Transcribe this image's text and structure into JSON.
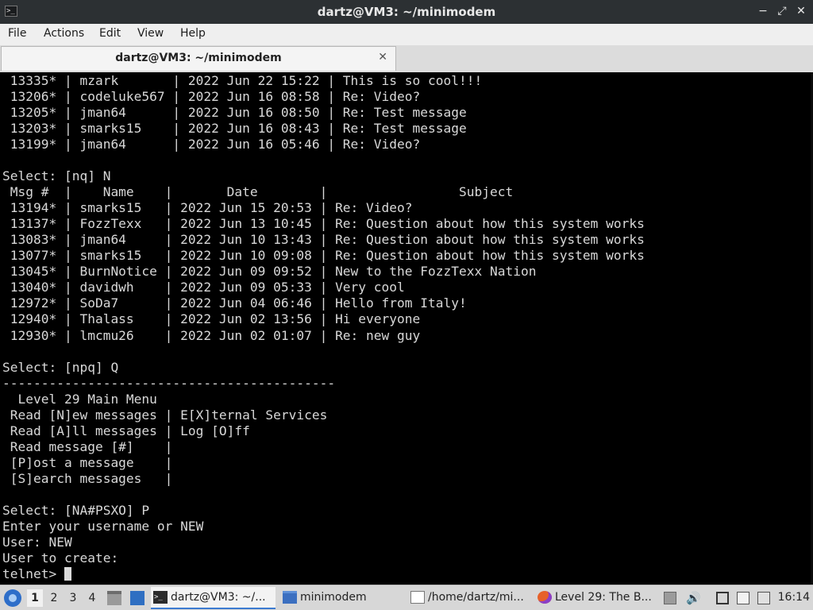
{
  "window": {
    "title": "dartz@VM3: ~/minimodem",
    "terminal_icon": ">_",
    "controls": {
      "minimize": "−",
      "maximize": "⤢",
      "close": "✕"
    }
  },
  "menu": [
    "File",
    "Actions",
    "Edit",
    "View",
    "Help"
  ],
  "tab": {
    "label": "dartz@VM3: ~/minimodem",
    "close": "✕"
  },
  "terminal": {
    "lines": [
      " 13335* | mzark       | 2022 Jun 22 15:22 | This is so cool!!!",
      " 13206* | codeluke567 | 2022 Jun 16 08:58 | Re: Video?",
      " 13205* | jman64      | 2022 Jun 16 08:50 | Re: Test message",
      " 13203* | smarks15    | 2022 Jun 16 08:43 | Re: Test message",
      " 13199* | jman64      | 2022 Jun 16 05:46 | Re: Video?",
      "",
      "Select: [nq] N",
      " Msg #  |    Name    |       Date        |                 Subject",
      " 13194* | smarks15   | 2022 Jun 15 20:53 | Re: Video?",
      " 13137* | FozzTexx   | 2022 Jun 13 10:45 | Re: Question about how this system works",
      " 13083* | jman64     | 2022 Jun 10 13:43 | Re: Question about how this system works",
      " 13077* | smarks15   | 2022 Jun 10 09:08 | Re: Question about how this system works",
      " 13045* | BurnNotice | 2022 Jun 09 09:52 | New to the FozzTexx Nation",
      " 13040* | davidwh    | 2022 Jun 09 05:33 | Very cool",
      " 12972* | SoDa7      | 2022 Jun 04 06:46 | Hello from Italy!",
      " 12940* | Thalass    | 2022 Jun 02 13:56 | Hi everyone",
      " 12930* | lmcmu26    | 2022 Jun 02 01:07 | Re: new guy",
      "",
      "Select: [npq] Q",
      "-------------------------------------------",
      "  Level 29 Main Menu",
      " Read [N]ew messages | E[X]ternal Services",
      " Read [A]ll messages | Log [O]ff",
      " Read message [#]    |",
      " [P]ost a message    |",
      " [S]earch messages   |",
      "",
      "Select: [NA#PSXO] P",
      "Enter your username or NEW",
      "User: NEW",
      "User to create:"
    ],
    "prompt": "telnet> "
  },
  "taskbar": {
    "workspaces": [
      "1",
      "2",
      "3",
      "4"
    ],
    "active_workspace": "1",
    "tasks": [
      {
        "label": "dartz@VM3: ~/...",
        "icon": "terminal-icon"
      },
      {
        "label": "minimodem",
        "icon": "folder-icon"
      },
      {
        "label": "/home/dartz/mi...",
        "icon": "text-editor-icon"
      },
      {
        "label": "Level 29: The B...",
        "icon": "firefox-icon"
      }
    ],
    "clock": "16:14"
  }
}
